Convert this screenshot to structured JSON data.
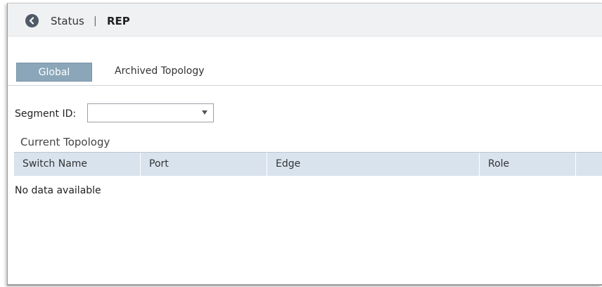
{
  "header": {
    "back_icon": "chevron-left-icon",
    "status_label": "Status",
    "separator": "|",
    "page_name": "REP"
  },
  "tabs": [
    {
      "label": "Global",
      "active": true
    },
    {
      "label": "Archived Topology",
      "active": false
    }
  ],
  "segment": {
    "label": "Segment ID:",
    "selected_value": ""
  },
  "current_topology": {
    "title": "Current Topology",
    "columns": [
      "Switch Name",
      "Port",
      "Edge",
      "Role",
      ""
    ],
    "empty_message": "No data available"
  },
  "colors": {
    "header_bg": "#f0f1f3",
    "active_tab_bg": "#8ba6b8",
    "table_header_bg": "#d8e3ee",
    "back_button": "#4e5a68"
  }
}
